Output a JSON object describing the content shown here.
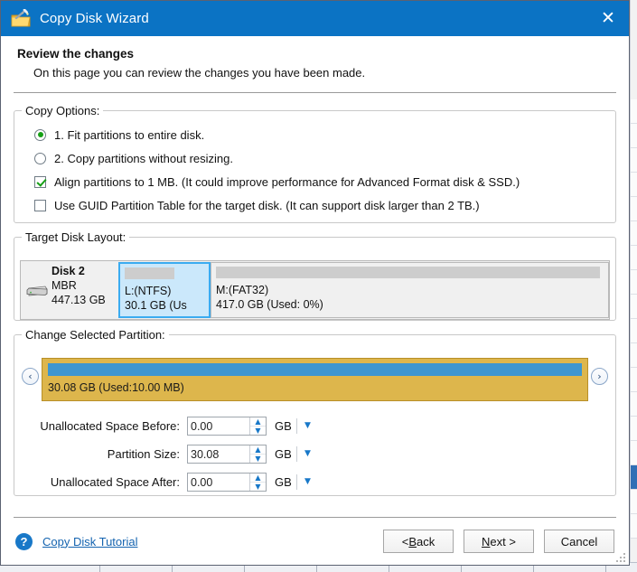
{
  "window": {
    "title": "Copy Disk Wizard",
    "icon": "wizard-wand-folder-icon",
    "close_label": "✕",
    "titlebar_color": "#0b73c4"
  },
  "header": {
    "heading": "Review the changes",
    "subheading": "On this page you can review the changes you have been made."
  },
  "copy_options": {
    "legend": "Copy Options:",
    "items": [
      {
        "type": "radio",
        "checked": true,
        "label": "1. Fit partitions to entire disk."
      },
      {
        "type": "radio",
        "checked": false,
        "label": "2. Copy partitions without resizing."
      },
      {
        "type": "checkbox",
        "checked": true,
        "label": "Align partitions to 1 MB.  (It could improve performance for Advanced Format disk & SSD.)"
      },
      {
        "type": "checkbox",
        "checked": false,
        "label": "Use GUID Partition Table for the target disk. (It can support disk larger than 2 TB.)"
      }
    ]
  },
  "target_disk": {
    "legend": "Target Disk Layout:",
    "disk": {
      "name": "Disk 2",
      "scheme": "MBR",
      "size": "447.13 GB"
    },
    "partitions": [
      {
        "label": "L:(NTFS)",
        "size": "30.1 GB (Us",
        "selected": true,
        "used_pct": 62,
        "width_pct": 17
      },
      {
        "label": "M:(FAT32)",
        "size": "417.0 GB (Used: 0%)",
        "selected": false,
        "used_pct": 98,
        "width_pct": 83
      }
    ]
  },
  "change_partition": {
    "legend": "Change Selected Partition:",
    "prev_arrow": "‹",
    "next_arrow": "›",
    "bar_label": "30.08 GB (Used:10.00 MB)",
    "bar_color": "#ddb64c",
    "used_color": "#3d96d0",
    "used_fill_pct": 100,
    "fields": [
      {
        "label": "Unallocated Space Before:",
        "value": "0.00",
        "unit": "GB"
      },
      {
        "label": "Partition Size:",
        "value": "30.08",
        "unit": "GB"
      },
      {
        "label": "Unallocated Space After:",
        "value": "0.00",
        "unit": "GB"
      }
    ],
    "spin_up": "▲",
    "spin_down": "▼",
    "unit_dropdown": "▼"
  },
  "footer": {
    "help_icon": "question-mark-icon",
    "help_glyph": "?",
    "help_link": "Copy Disk Tutorial",
    "buttons": [
      {
        "name": "back",
        "pre": "< ",
        "accel": "B",
        "post": "ack"
      },
      {
        "name": "next",
        "pre": "",
        "accel": "N",
        "post": "ext >"
      },
      {
        "name": "cancel",
        "pre": "Cancel",
        "accel": "",
        "post": ""
      }
    ]
  }
}
